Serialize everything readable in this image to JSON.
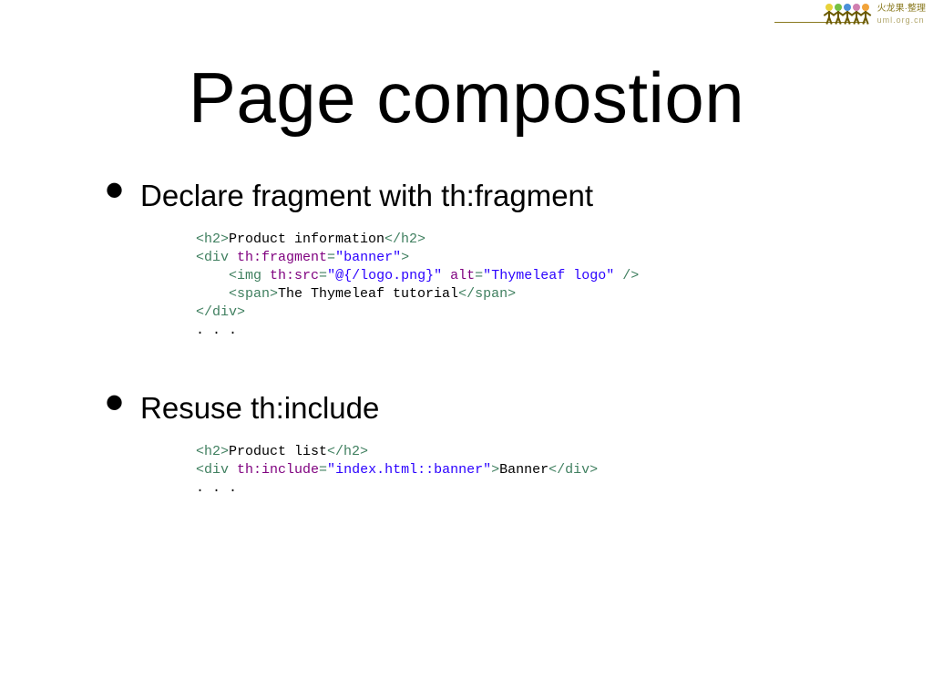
{
  "title": "Page compostion",
  "watermark": {
    "line1": "火龙果·整理",
    "line2": "uml.org.cn"
  },
  "bullets": [
    {
      "text": "Declare fragment with th:fragment"
    },
    {
      "text": "Resuse th:include"
    }
  ],
  "code1": {
    "h2_text": "Product information",
    "fragment_name": "banner",
    "img_src": "@{/logo.png}",
    "img_alt": "Thymeleaf logo",
    "span_text": "The Thymeleaf tutorial",
    "ellipsis": ". . ."
  },
  "code2": {
    "h2_text": "Product list",
    "include_ref": "index.html::banner",
    "div_text": "Banner",
    "ellipsis": ". . ."
  }
}
